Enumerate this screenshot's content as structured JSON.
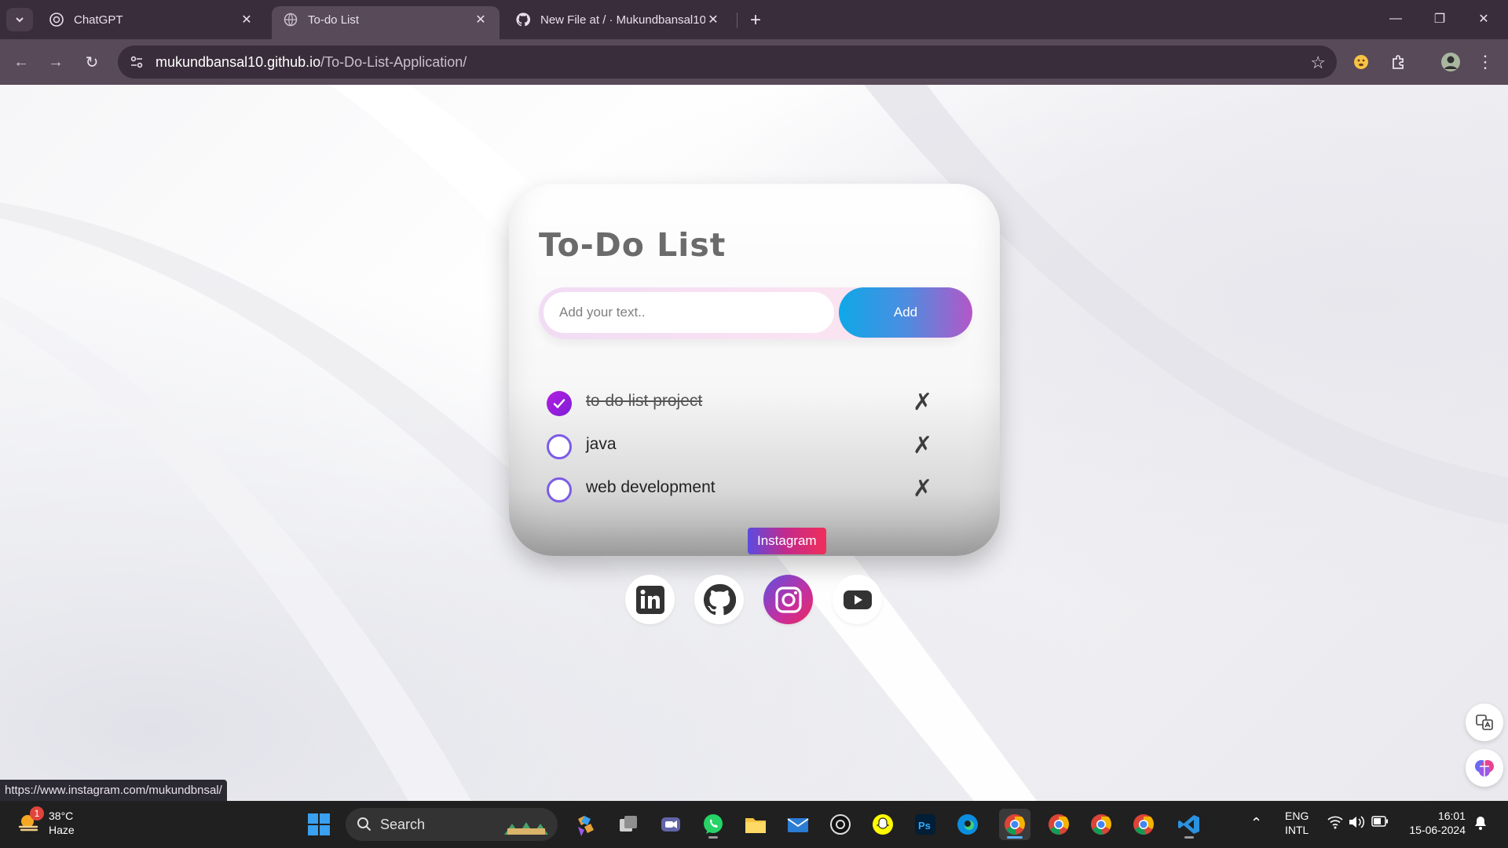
{
  "browser": {
    "tabs": [
      {
        "title": "ChatGPT",
        "icon": "chatgpt-icon"
      },
      {
        "title": "To-do List",
        "icon": "globe-icon",
        "active": true
      },
      {
        "title": "New File at / · Mukundbansal10",
        "icon": "github-icon"
      }
    ],
    "url_host": "mukundbansal10.github.io",
    "url_path": "/To-Do-List-Application/"
  },
  "app": {
    "title": "To-Do List",
    "input_placeholder": "Add your text..",
    "add_label": "Add",
    "tasks": [
      {
        "text": "to-do list project",
        "done": true
      },
      {
        "text": "java",
        "done": false
      },
      {
        "text": "web development",
        "done": false
      }
    ],
    "delete_symbol": "✗",
    "tooltip": "Instagram",
    "socials": [
      "linkedin-icon",
      "github-icon",
      "instagram-icon",
      "youtube-icon"
    ]
  },
  "status_url": "https://www.instagram.com/mukundbnsal/",
  "taskbar": {
    "weather_temp": "38°C",
    "weather_desc": "Haze",
    "weather_badge": "1",
    "search_label": "Search",
    "lang_line1": "ENG",
    "lang_line2": "INTL",
    "time": "16:01",
    "date": "15-06-2024"
  },
  "colors": {
    "accent_gradient_start": "#0ea8e8",
    "accent_gradient_end": "#b457c7",
    "checked": "#b31ee0"
  }
}
